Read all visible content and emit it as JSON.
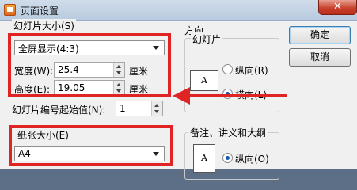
{
  "window": {
    "title": "页面设置",
    "close_glyph": "✕"
  },
  "slide_size": {
    "group_label": "幻灯片大小(S)",
    "selected": "全屏显示(4:3)",
    "width_label": "宽度(W):",
    "width_value": "25.4",
    "width_unit": "厘米",
    "height_label": "高度(E):",
    "height_value": "19.05",
    "height_unit": "厘米",
    "numbering_label": "幻灯片编号起始值(N):",
    "numbering_value": "1"
  },
  "paper_size": {
    "group_label": "纸张大小(E)",
    "selected": "A4"
  },
  "orientation": {
    "group_label": "方向",
    "slides": {
      "label": "幻灯片",
      "page_letter": "A",
      "portrait": "纵向(R)",
      "landscape": "横向(L)",
      "selected": "landscape"
    },
    "notes": {
      "label": "备注、讲义和大纲",
      "page_letter": "A",
      "portrait": "纵向(O)",
      "selected": "portrait"
    }
  },
  "buttons": {
    "ok": "确定",
    "cancel": "取消"
  },
  "annotation_colors": {
    "highlight": "#e02424"
  }
}
